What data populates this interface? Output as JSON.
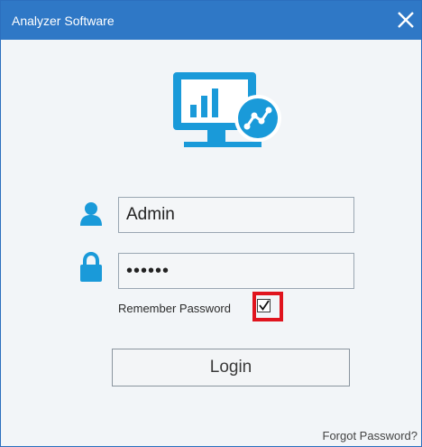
{
  "window": {
    "title": "Analyzer Software",
    "close_icon": "close-icon"
  },
  "logo": {
    "icon": "analytics-monitor-icon",
    "accent": "#1a9ad9"
  },
  "form": {
    "username": {
      "value": "Admin",
      "icon": "user-icon"
    },
    "password": {
      "value": "••••••",
      "icon": "lock-icon"
    },
    "remember": {
      "label": "Remember Password",
      "checked": true
    },
    "login_label": "Login",
    "forgot_label": "Forgot Password?"
  },
  "colors": {
    "titlebar": "#2f78c6",
    "icon_blue": "#1a9ad9",
    "highlight_red": "#e0141e"
  }
}
